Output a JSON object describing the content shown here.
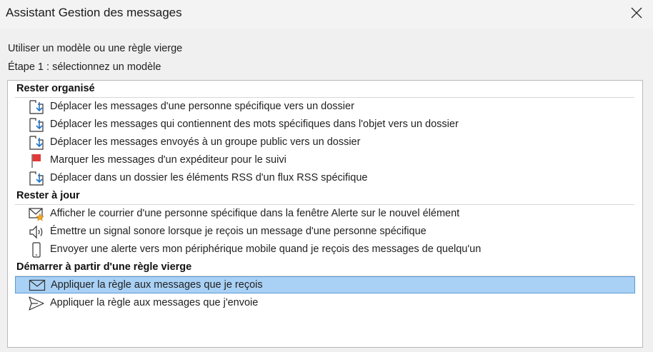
{
  "window": {
    "title": "Assistant Gestion des messages"
  },
  "intro": {
    "line1": "Utiliser un modèle ou une règle vierge",
    "line2": "Étape 1 : sélectionnez un modèle"
  },
  "groups": [
    {
      "header": "Rester organisé",
      "items": [
        {
          "label": "Déplacer les messages d'une personne spécifique vers un dossier",
          "icon": "move-to-folder-icon"
        },
        {
          "label": "Déplacer les messages qui contiennent des mots spécifiques dans l'objet vers un dossier",
          "icon": "move-to-folder-icon"
        },
        {
          "label": "Déplacer les messages envoyés à un groupe public vers un dossier",
          "icon": "move-to-folder-icon"
        },
        {
          "label": "Marquer les messages d'un expéditeur pour le suivi",
          "icon": "red-flag-icon"
        },
        {
          "label": "Déplacer dans un dossier les éléments RSS d'un flux RSS spécifique",
          "icon": "move-to-folder-icon"
        }
      ]
    },
    {
      "header": "Rester à jour",
      "items": [
        {
          "label": "Afficher le courrier d'une personne spécifique dans la fenêtre Alerte sur le nouvel élément",
          "icon": "mail-star-icon"
        },
        {
          "label": "Émettre un signal sonore lorsque je reçois un message d'une personne spécifique",
          "icon": "speaker-icon"
        },
        {
          "label": "Envoyer une alerte vers mon périphérique mobile quand je reçois des messages de quelqu'un",
          "icon": "mobile-phone-icon"
        }
      ]
    },
    {
      "header": "Démarrer à partir d'une règle vierge",
      "items": [
        {
          "label": "Appliquer la règle aux messages que je reçois",
          "icon": "envelope-icon",
          "selected": true
        },
        {
          "label": "Appliquer la règle aux messages que j'envoie",
          "icon": "send-arrow-icon"
        }
      ]
    }
  ],
  "colors": {
    "selection": "#a9d1f5",
    "selection_border": "#5c9bd6",
    "folder_arrow": "#1e73c8",
    "flag": "#e23a3a",
    "star": "#f2a81d"
  }
}
